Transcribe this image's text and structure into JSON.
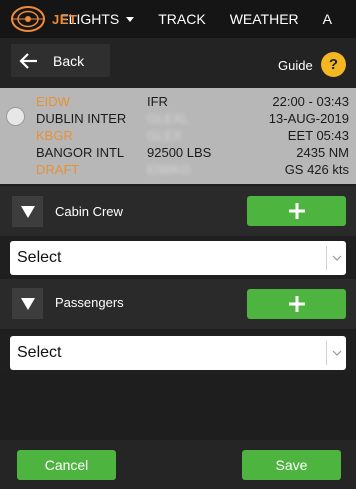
{
  "nav": {
    "logo_text": "JET",
    "items": [
      {
        "label": "FLIGHTS",
        "has_dropdown": true
      },
      {
        "label": "TRACK"
      },
      {
        "label": "WEATHER"
      },
      {
        "label": "A"
      }
    ]
  },
  "subbar": {
    "back_label": "Back",
    "guide_label": "Guide",
    "help_symbol": "?"
  },
  "flight": {
    "rows": [
      {
        "a": "EIDW",
        "a_orange": true,
        "b": "IFR",
        "b_blurred": false,
        "c": "22:00 - 03:43"
      },
      {
        "a": "DUBLIN INTER",
        "a_orange": false,
        "b": "GLEXL",
        "b_blurred": true,
        "c": "13-AUG-2019"
      },
      {
        "a": "KBGR",
        "a_orange": true,
        "b": "GLEX",
        "b_blurred": true,
        "c": "EET 05:43"
      },
      {
        "a": "BANGOR INTL",
        "a_orange": false,
        "b": "92500 LBS",
        "b_blurred": false,
        "c": "2435 NM"
      },
      {
        "a": "DRAFT",
        "a_orange": true,
        "b": "EIWKO",
        "b_blurred": true,
        "c": "GS 426 kts"
      }
    ]
  },
  "sections": {
    "cabin_crew": {
      "label": "Cabin Crew",
      "select_value": "Select"
    },
    "passengers": {
      "label": "Passengers",
      "select_value": "Select"
    }
  },
  "footer": {
    "cancel_label": "Cancel",
    "save_label": "Save"
  },
  "colors": {
    "accent_green": "#4cb43f",
    "accent_orange": "#e6913a",
    "help_yellow": "#f3b722"
  },
  "icons": [
    "jet-logo-icon",
    "caret-down-icon",
    "arrow-left-icon",
    "help-icon",
    "radio-icon",
    "collapse-triangle-icon",
    "plus-icon",
    "select-chevron-icon"
  ]
}
